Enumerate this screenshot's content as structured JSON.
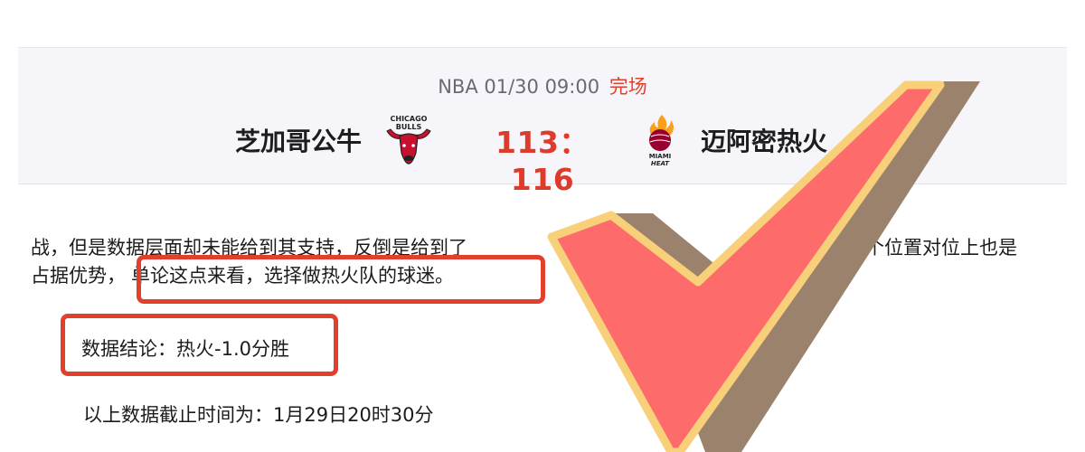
{
  "match": {
    "league": "NBA",
    "datetime": "01/30 09:00",
    "status": "完场",
    "home_team": "芝加哥公牛",
    "away_team": "迈阿密热火",
    "score": "113：116"
  },
  "article": {
    "line1_start": "战，但是数据层面却未能给到其支持，反倒是给到了",
    "line1_end": "多个位置对位上也是",
    "line2_plain": "占据优势，",
    "line2_highlight": "单论这点来看，选择做热火队的球迷。",
    "conclusion": "数据结论：热火-1.0分胜",
    "deadline": "以上数据截止时间为：1月29日20时30分"
  },
  "colors": {
    "status": "#e2402d",
    "score": "#dd3b2c",
    "highlight_box": "#e2402d",
    "check_fill": "#fe6b6b",
    "check_outline": "#f8d07a",
    "check_shadow": "#9a826d"
  },
  "icons": [
    "bulls-logo-icon",
    "heat-logo-icon",
    "checkmark-overlay-icon"
  ]
}
